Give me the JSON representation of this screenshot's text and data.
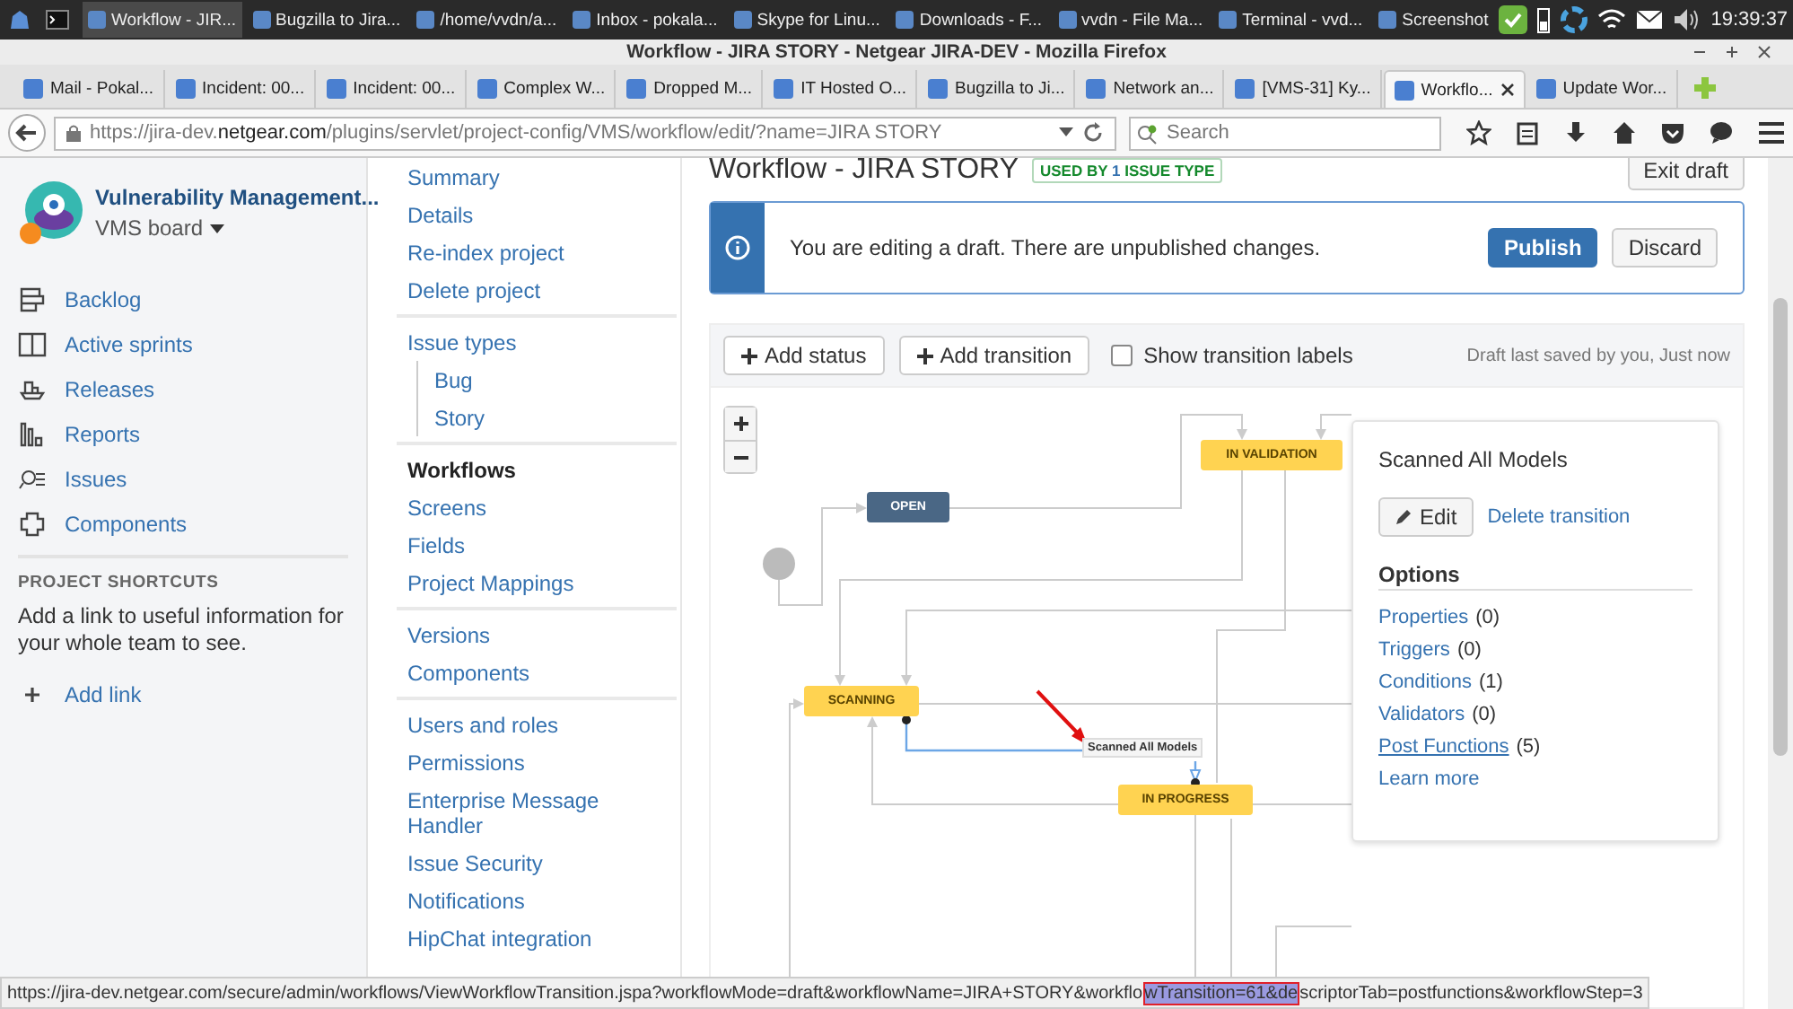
{
  "taskbar": {
    "items": [
      {
        "label": "Workflow - JIR...",
        "selected": true
      },
      {
        "label": "Bugzilla to Jira...",
        "selected": false
      },
      {
        "label": "/home/vvdn/a...",
        "selected": false
      },
      {
        "label": "Inbox - pokala...",
        "selected": false
      },
      {
        "label": "Skype for Linu...",
        "selected": false
      },
      {
        "label": "Downloads - F...",
        "selected": false
      },
      {
        "label": "vvdn - File Ma...",
        "selected": false
      },
      {
        "label": "Terminal - vvd...",
        "selected": false
      },
      {
        "label": "Screenshot",
        "selected": false
      }
    ],
    "clock": "19:39:37"
  },
  "window": {
    "title": "Workflow - JIRA STORY - Netgear JIRA-DEV - Mozilla Firefox"
  },
  "tabs": [
    {
      "label": "Mail - Pokal...",
      "selected": false
    },
    {
      "label": "Incident: 00...",
      "selected": false
    },
    {
      "label": "Incident: 00...",
      "selected": false
    },
    {
      "label": "Complex W...",
      "selected": false
    },
    {
      "label": "Dropped M...",
      "selected": false
    },
    {
      "label": "IT Hosted O...",
      "selected": false
    },
    {
      "label": "Bugzilla to Ji...",
      "selected": false
    },
    {
      "label": "Network an...",
      "selected": false
    },
    {
      "label": "[VMS-31] Ky...",
      "selected": false
    },
    {
      "label": "Workflo...",
      "selected": true
    },
    {
      "label": "Update Wor...",
      "selected": false
    }
  ],
  "address_bar": {
    "url_prefix": "https://jira-dev.",
    "url_domain": "netgear.com",
    "url_path": "/plugins/servlet/project-config/VMS/workflow/edit/?name=JIRA STORY"
  },
  "search": {
    "placeholder": "Search"
  },
  "sidebar": {
    "project_name": "Vulnerability Management...",
    "board": "VMS board",
    "items": [
      {
        "label": "Backlog"
      },
      {
        "label": "Active sprints"
      },
      {
        "label": "Releases"
      },
      {
        "label": "Reports"
      },
      {
        "label": "Issues"
      },
      {
        "label": "Components"
      }
    ],
    "shortcuts_heading": "PROJECT SHORTCUTS",
    "shortcuts_text": "Add a link to useful information for your whole team to see.",
    "add_link": "Add link"
  },
  "settings_nav": [
    {
      "items": [
        {
          "label": "Summary",
          "selected": false
        },
        {
          "label": "Details",
          "selected": false
        },
        {
          "label": "Re-index project",
          "selected": false
        },
        {
          "label": "Delete project",
          "selected": false
        }
      ]
    },
    {
      "items": [
        {
          "label": "Issue types",
          "selected": false,
          "children": [
            {
              "label": "Bug",
              "selected": false
            },
            {
              "label": "Story",
              "selected": false
            }
          ]
        }
      ]
    },
    {
      "items": [
        {
          "label": "Workflows",
          "selected": true
        },
        {
          "label": "Screens",
          "selected": false
        },
        {
          "label": "Fields",
          "selected": false
        },
        {
          "label": "Project Mappings",
          "selected": false
        }
      ]
    },
    {
      "items": [
        {
          "label": "Versions",
          "selected": false
        },
        {
          "label": "Components",
          "selected": false
        }
      ]
    },
    {
      "items": [
        {
          "label": "Users and roles",
          "selected": false
        },
        {
          "label": "Permissions",
          "selected": false
        },
        {
          "label": "Enterprise Message Handler",
          "selected": false
        },
        {
          "label": "Issue Security",
          "selected": false
        },
        {
          "label": "Notifications",
          "selected": false
        },
        {
          "label": "HipChat integration",
          "selected": false
        }
      ]
    }
  ],
  "page": {
    "title": "Workflow - JIRA STORY",
    "badge_prefix": "USED BY",
    "badge_count": "1",
    "badge_suffix": "ISSUE TYPE",
    "exit_button": "Exit draft"
  },
  "banner": {
    "message": "You are editing a draft. There are unpublished changes.",
    "publish": "Publish",
    "discard": "Discard"
  },
  "toolbar": {
    "add_status": "Add status",
    "add_transition": "Add transition",
    "show_labels": {
      "label": "Show transition labels",
      "checked": false
    },
    "saved": "Draft last saved by you, Just now"
  },
  "diagram": {
    "statuses": [
      {
        "label": "IN VALIDATION",
        "color": "#ffd351"
      },
      {
        "label": "OPEN",
        "color": "#4a6785"
      },
      {
        "label": "SCANNING",
        "color": "#ffd351"
      },
      {
        "label": "IN PROGRESS",
        "color": "#ffd351"
      }
    ],
    "selected_transition": "Scanned All Models"
  },
  "transition_panel": {
    "title": "Scanned All Models",
    "edit": "Edit",
    "delete": "Delete transition",
    "options_heading": "Options",
    "options": [
      {
        "label": "Properties",
        "count": "(0)",
        "hovered": false
      },
      {
        "label": "Triggers",
        "count": "(0)",
        "hovered": false
      },
      {
        "label": "Conditions",
        "count": "(1)",
        "hovered": false
      },
      {
        "label": "Validators",
        "count": "(0)",
        "hovered": false
      },
      {
        "label": "Post Functions",
        "count": "(5)",
        "hovered": true
      }
    ],
    "learn_more": "Learn more"
  },
  "status_url": {
    "before": "https://jira-dev.netgear.com/secure/admin/workflows/ViewWorkflowTransition.jspa?workflowMode=draft&workflowName=JIRA+STORY&workflo",
    "highlighted": "wTransition=61&de",
    "after": "scriptorTab=postfunctions&workflowStep=3"
  }
}
